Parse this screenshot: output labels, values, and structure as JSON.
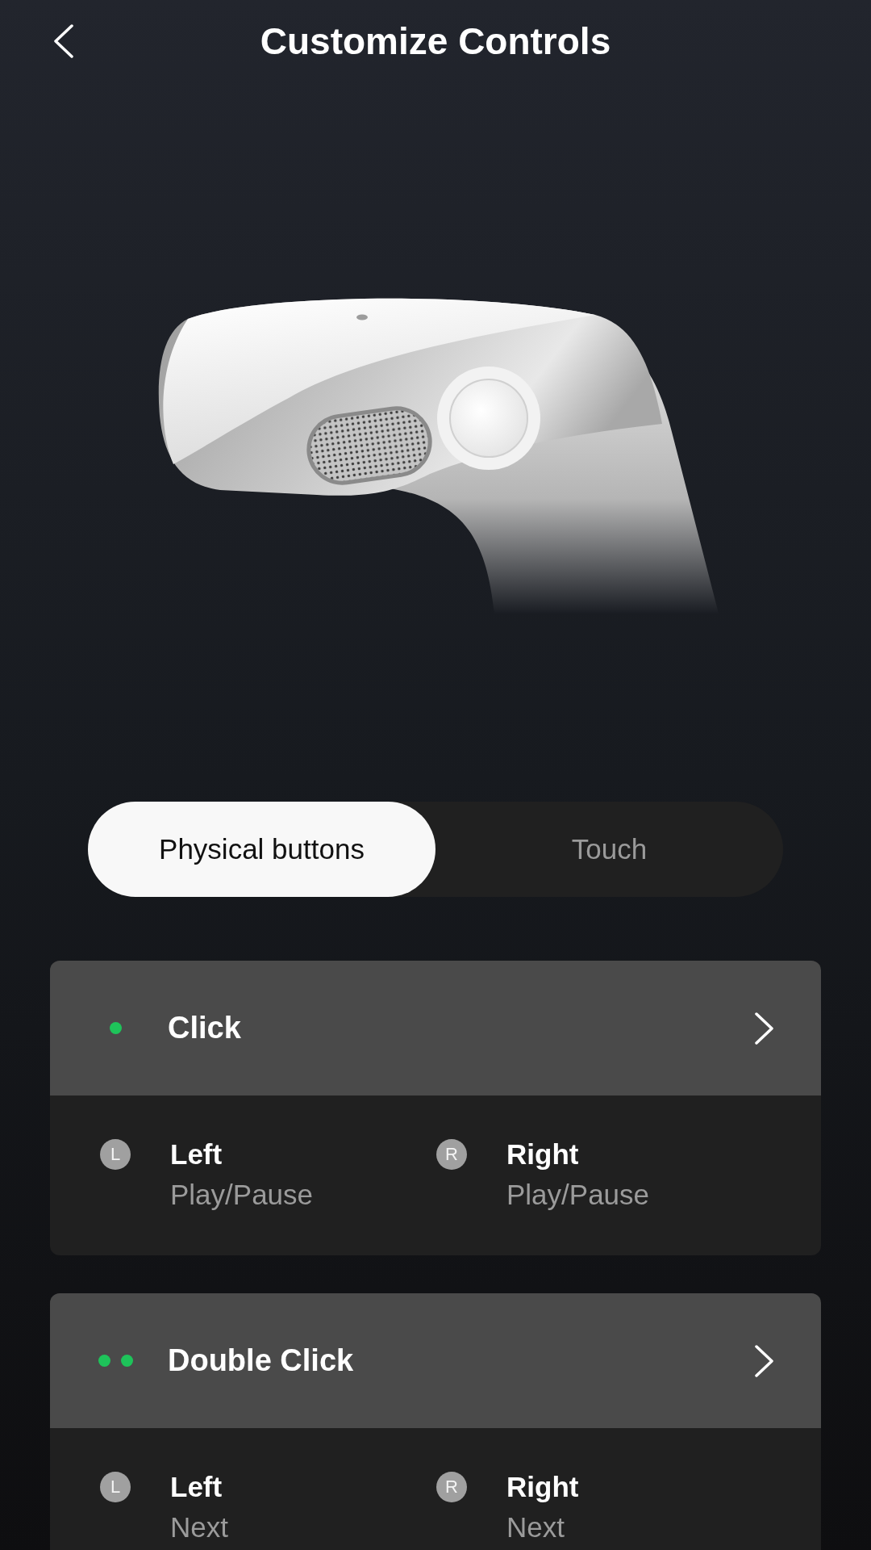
{
  "header": {
    "title": "Customize Controls"
  },
  "tabs": [
    {
      "label": "Physical buttons",
      "selected": true
    },
    {
      "label": "Touch",
      "selected": false
    }
  ],
  "gestures": [
    {
      "kind": "click",
      "title": "Click",
      "sides": [
        {
          "badge": "L",
          "label": "Left",
          "action": "Play/Pause"
        },
        {
          "badge": "R",
          "label": "Right",
          "action": "Play/Pause"
        }
      ]
    },
    {
      "kind": "double_click",
      "title": "Double Click",
      "sides": [
        {
          "badge": "L",
          "label": "Left",
          "action": "Next"
        },
        {
          "badge": "R",
          "label": "Right",
          "action": "Next"
        }
      ]
    }
  ]
}
